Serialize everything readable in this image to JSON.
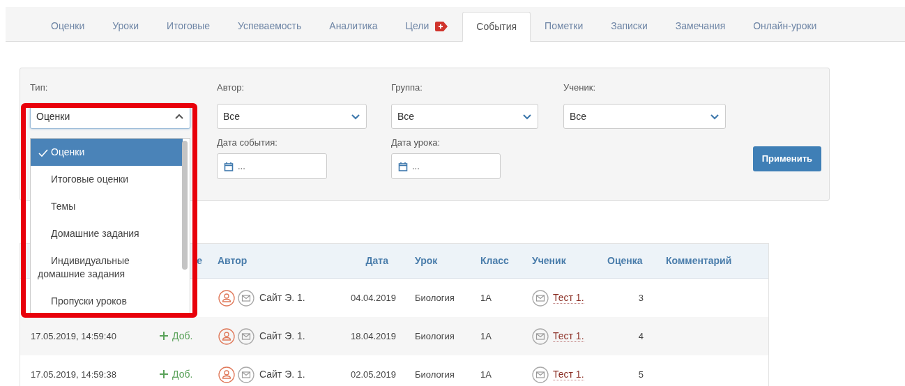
{
  "tabs": [
    {
      "label": "Оценки",
      "selected": false,
      "kind": "plain"
    },
    {
      "label": "Уроки",
      "selected": false,
      "kind": "plain"
    },
    {
      "label": "Итоговые",
      "selected": false,
      "kind": "plain"
    },
    {
      "label": "Успеваемость",
      "selected": false,
      "kind": "plain"
    },
    {
      "label": "Аналитика",
      "selected": false,
      "kind": "plain"
    },
    {
      "label": "Цели",
      "selected": false,
      "kind": "flagged"
    },
    {
      "label": "События",
      "selected": true,
      "kind": "plain"
    },
    {
      "label": "Пометки",
      "selected": false,
      "kind": "plain"
    },
    {
      "label": "Записки",
      "selected": false,
      "kind": "plain"
    },
    {
      "label": "Замечания",
      "selected": false,
      "kind": "plain"
    },
    {
      "label": "Онлайн-уроки",
      "selected": false,
      "kind": "plain"
    }
  ],
  "filters": {
    "type": {
      "label": "Тип:",
      "value": "Оценки",
      "expanded": true,
      "options": [
        {
          "label": "Оценки",
          "selected": true
        },
        {
          "label": "Итоговые оценки",
          "selected": false
        },
        {
          "label": "Темы",
          "selected": false
        },
        {
          "label": "Домашние задания",
          "selected": false
        },
        {
          "label": "Индивидуальные домашние задания",
          "selected": false
        },
        {
          "label": "Пропуски уроков",
          "selected": false
        }
      ]
    },
    "author": {
      "label": "Автор:",
      "value": "Все",
      "expanded": false
    },
    "group": {
      "label": "Группа:",
      "value": "Все",
      "expanded": false
    },
    "student": {
      "label": "Ученик:",
      "value": "Все",
      "expanded": false
    },
    "event_date": {
      "label": "Дата события:",
      "placeholder": "..."
    },
    "lesson_date": {
      "label": "Дата урока:",
      "placeholder": "..."
    },
    "apply_button": "Применить"
  },
  "table": {
    "columns": [
      "е",
      "Автор",
      "Дата",
      "Урок",
      "Класс",
      "Ученик",
      "Оценка",
      "Комментарий"
    ],
    "rows": [
      {
        "author": "Сайт Э. 1.",
        "date": "04.04.2019",
        "lesson": "Биология",
        "class": "1А",
        "student": "Тест 1.",
        "grade": "3"
      },
      {
        "time": "17.05.2019, 14:59:40",
        "action": "Доб.",
        "author": "Сайт Э. 1.",
        "date": "18.04.2019",
        "lesson": "Биология",
        "class": "1А",
        "student": "Тест 1.",
        "grade": "4"
      },
      {
        "time": "17.05.2019, 14:59:38",
        "action": "Доб.",
        "author": "Сайт Э. 1.",
        "date": "02.05.2019",
        "lesson": "Биология",
        "class": "1А",
        "student": "Тест 1.",
        "grade": "5"
      }
    ]
  }
}
